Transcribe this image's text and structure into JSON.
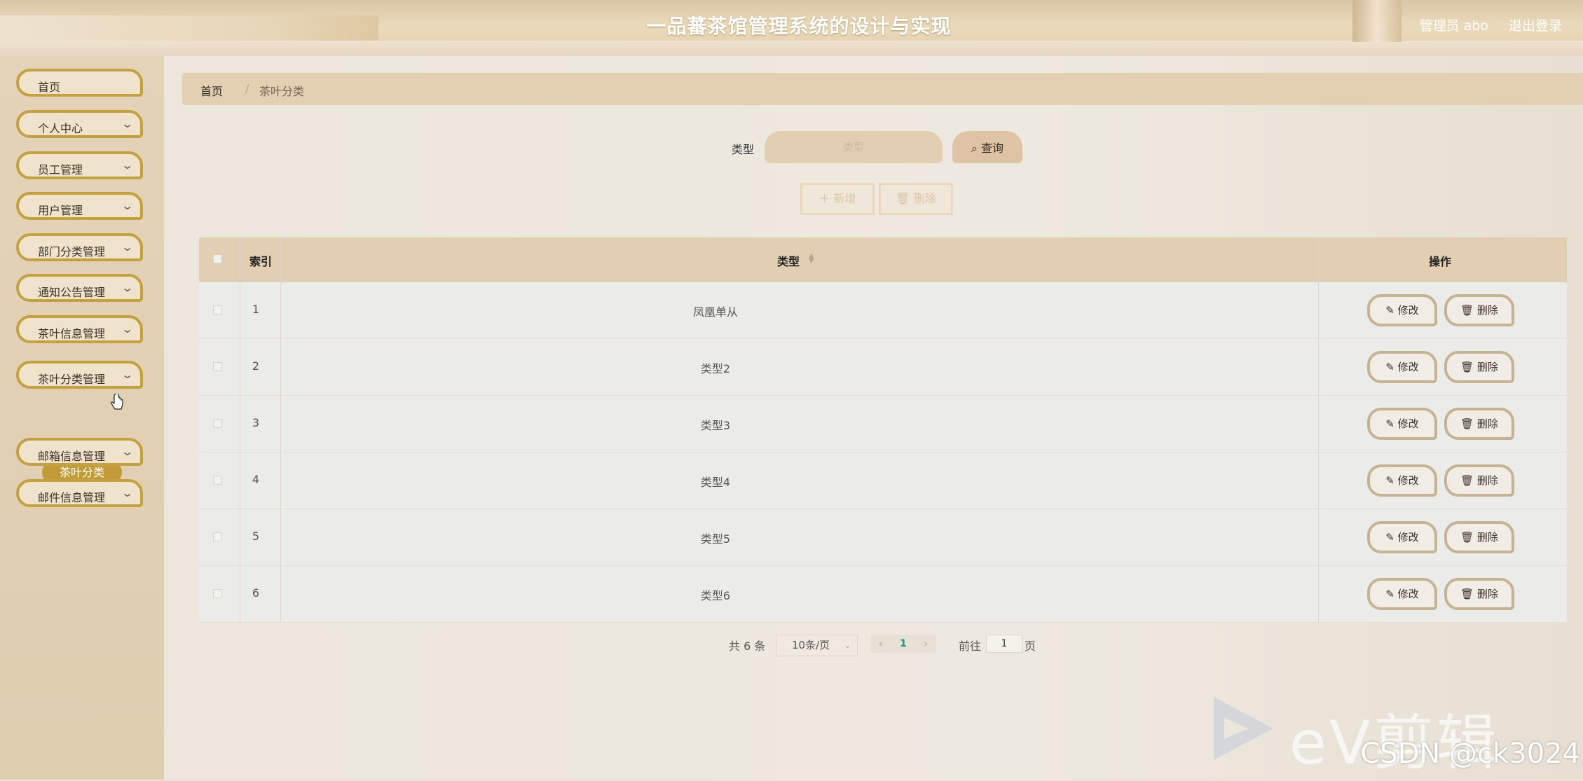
{
  "header": {
    "title": "一品蕃茶馆管理系统的设计与实现",
    "user": "管理员 abo",
    "logout": "退出登录"
  },
  "sidebar": {
    "items": [
      {
        "label": "首页"
      },
      {
        "label": "个人中心"
      },
      {
        "label": "员工管理"
      },
      {
        "label": "用户管理"
      },
      {
        "label": "部门分类管理"
      },
      {
        "label": "通知公告管理"
      },
      {
        "label": "茶叶信息管理"
      },
      {
        "label": "茶叶分类管理"
      },
      {
        "label": "邮箱信息管理"
      },
      {
        "label": "邮件信息管理"
      }
    ],
    "active_sub": "茶叶分类"
  },
  "breadcrumb": {
    "home": "首页",
    "separator": "/",
    "current": "茶叶分类"
  },
  "search": {
    "label": "类型",
    "placeholder": "类型",
    "button": "查询"
  },
  "toolbar": {
    "add": "＋ 新增",
    "delete": "删除"
  },
  "table": {
    "columns": [
      "索引",
      "类型",
      "操作"
    ],
    "rows": [
      {
        "index": "1",
        "type": "凤凰单从"
      },
      {
        "index": "2",
        "type": "类型2"
      },
      {
        "index": "3",
        "type": "类型3"
      },
      {
        "index": "4",
        "type": "类型4"
      },
      {
        "index": "5",
        "type": "类型5"
      },
      {
        "index": "6",
        "type": "类型6"
      }
    ],
    "edit_label": "修改",
    "delete_label": "删除"
  },
  "pagination": {
    "total": "共 6 条",
    "page_size": "10条/页",
    "current_page": "1",
    "goto_label": "前往",
    "goto_value": "1",
    "page_suffix": "页"
  },
  "watermark": {
    "ev": "eV剪辑",
    "csdn": "CSDN @ck3024"
  },
  "colors": {
    "accent_gold": "#c4a040",
    "header_bg": "#e2cfae",
    "active_sub_bg": "#c09b37"
  }
}
